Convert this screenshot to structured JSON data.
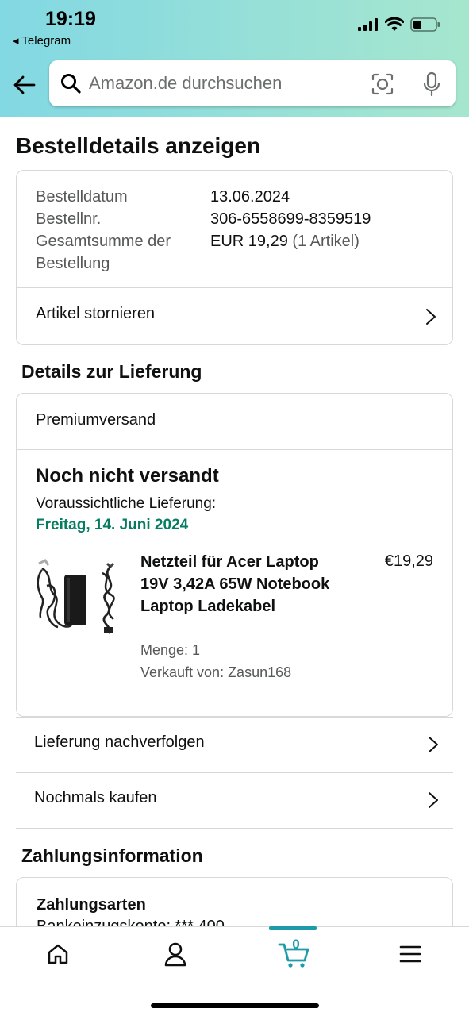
{
  "status_bar": {
    "time": "19:19",
    "back_app": "◂ Telegram"
  },
  "search": {
    "placeholder": "Amazon.de durchsuchen"
  },
  "page": {
    "title": "Bestelldetails anzeigen"
  },
  "order_summary": {
    "date_label": "Bestelldatum",
    "date_value": "13.06.2024",
    "number_label": "Bestellnr.",
    "number_value": "306-6558699-8359519",
    "total_label_line1": "Gesamtsumme der",
    "total_label_line2": "Bestellung",
    "total_value": "EUR 19,29",
    "total_items": "(1 Artikel)",
    "cancel_label": "Artikel stornieren"
  },
  "delivery": {
    "section_title": "Details zur Lieferung",
    "shipping_method": "Premiumversand",
    "status": "Noch nicht versandt",
    "expected_label": "Voraussichtliche Lieferung:",
    "expected_date": "Freitag, 14. Juni 2024",
    "product": {
      "name": "Netzteil für Acer Laptop 19V 3,42A 65W Notebook Laptop Ladekabel",
      "price": "€19,29",
      "quantity": "Menge: 1",
      "seller": "Verkauft von: Zasun168"
    }
  },
  "actions": {
    "track": "Lieferung nachverfolgen",
    "buy_again": "Nochmals kaufen"
  },
  "payment": {
    "section_title": "Zahlungsinformation",
    "methods_title": "Zahlungsarten",
    "method_value": "Bankeinzugskonto: *** 400"
  },
  "tabbar": {
    "cart_count": "0",
    "accent_color": "#1f9aa8"
  }
}
